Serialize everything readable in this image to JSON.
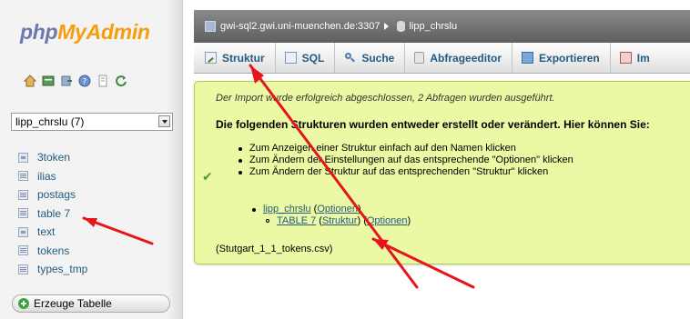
{
  "logo": {
    "php": "php",
    "my": "My",
    "admin": "Admin"
  },
  "nav": {
    "icons": [
      "home-icon",
      "sql-window-icon",
      "logout-icon",
      "help-icon",
      "docs-icon",
      "reload-icon"
    ],
    "db_select": "lipp_chrslu (7)",
    "tables": [
      {
        "name": "3token",
        "type": "view"
      },
      {
        "name": "ilias",
        "type": "table"
      },
      {
        "name": "postags",
        "type": "table"
      },
      {
        "name": "table 7",
        "type": "table"
      },
      {
        "name": "text",
        "type": "view"
      },
      {
        "name": "tokens",
        "type": "table"
      },
      {
        "name": "types_tmp",
        "type": "table"
      }
    ],
    "create_table": "Erzeuge Tabelle"
  },
  "breadcrumb": {
    "server": "gwi-sql2.gwi.uni-muenchen.de:3307",
    "database": "lipp_chrslu"
  },
  "tabs": [
    {
      "label": "Struktur",
      "icon": "structure-icon"
    },
    {
      "label": "SQL",
      "icon": "sql-icon"
    },
    {
      "label": "Suche",
      "icon": "search-icon"
    },
    {
      "label": "Abfrageeditor",
      "icon": "query-icon"
    },
    {
      "label": "Exportieren",
      "icon": "export-icon"
    },
    {
      "label": "Im",
      "icon": "import-icon"
    }
  ],
  "notice": {
    "message": "Der Import wurde erfolgreich abgeschlossen, 2 Abfragen wurden ausgeführt.",
    "heading": "Die folgenden Strukturen wurden entweder erstellt oder verändert. Hier können Sie:",
    "bullets": [
      "Zum Anzeigen einer Struktur einfach auf den Namen klicken",
      "Zum Ändern der Einstellungen auf das entsprechende \"Optionen\" klicken",
      "Zum Ändern der Struktur auf das entsprechenden \"Struktur\" klicken"
    ],
    "db_link": "lipp_chrslu",
    "db_options": "Optionen",
    "table_link": "TABLE 7",
    "table_structure": "Struktur",
    "table_options": "Optionen",
    "file": "(Stutgart_1_1_tokens.csv)"
  },
  "colors": {
    "accent": "#235a81",
    "notice_bg": "#ebf8a4",
    "notice_border": "#a2d246",
    "arrow": "#e8141c"
  }
}
